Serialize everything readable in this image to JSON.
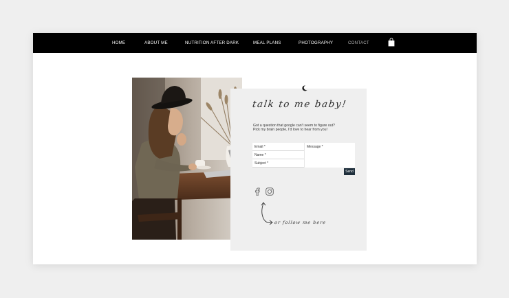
{
  "nav": {
    "items": [
      {
        "label": "HOME"
      },
      {
        "label": "ABOUT ME"
      },
      {
        "label": "NUTRITION AFTER DARK"
      },
      {
        "label": "MEAL PLANS"
      },
      {
        "label": "PHOTOGRAPHY"
      },
      {
        "label": "CONTACT"
      }
    ],
    "active": "CONTACT"
  },
  "contact": {
    "heading": "talk to me baby!",
    "intro_line1": "Got a question that google can't seem to figure out?",
    "intro_line2": "Pick my brain people, I'd love to hear from you!",
    "form": {
      "email_label": "Email *",
      "name_label": "Name *",
      "subject_label": "Subject *",
      "message_label": "Message *",
      "send_label": "Send"
    },
    "follow_text": "or follow me here"
  },
  "icons": [
    "cart-icon",
    "moon-icon",
    "facebook-icon",
    "instagram-icon",
    "arrow-icon"
  ],
  "colors": {
    "nav_bg": "#000000",
    "nav_text": "#ffffff",
    "nav_active": "#b5b5b5",
    "panel_bg": "#efefef",
    "send_bg": "#1f2f3c"
  }
}
